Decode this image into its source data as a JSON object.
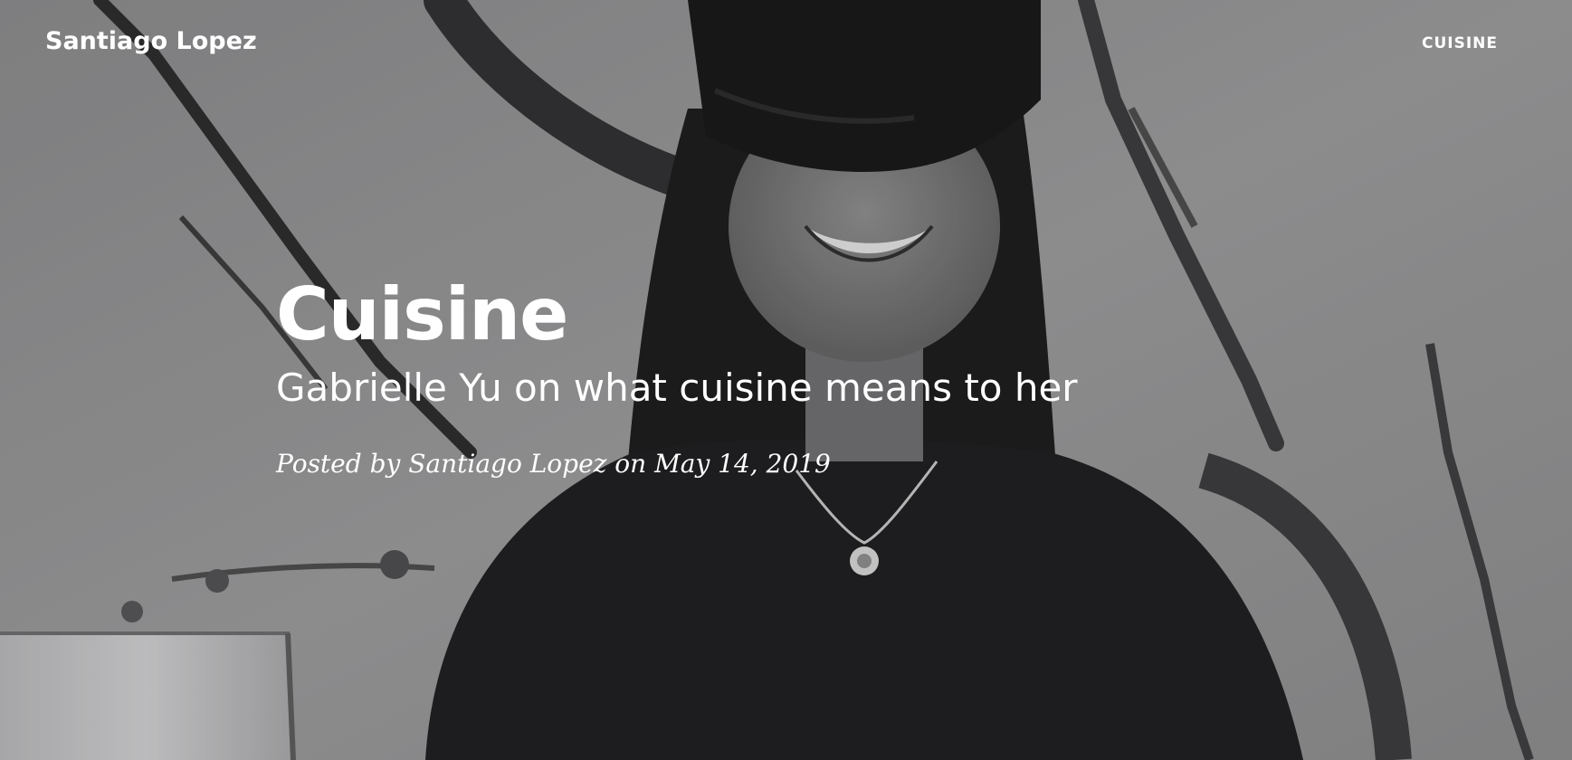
{
  "navbar": {
    "brand": "Santiago Lopez",
    "links": [
      "Cuisine"
    ]
  },
  "post": {
    "title": "Cuisine",
    "subtitle": "Gabrielle Yu on what cuisine means to her",
    "meta": "Posted by Santiago Lopez on May 14, 2019"
  }
}
